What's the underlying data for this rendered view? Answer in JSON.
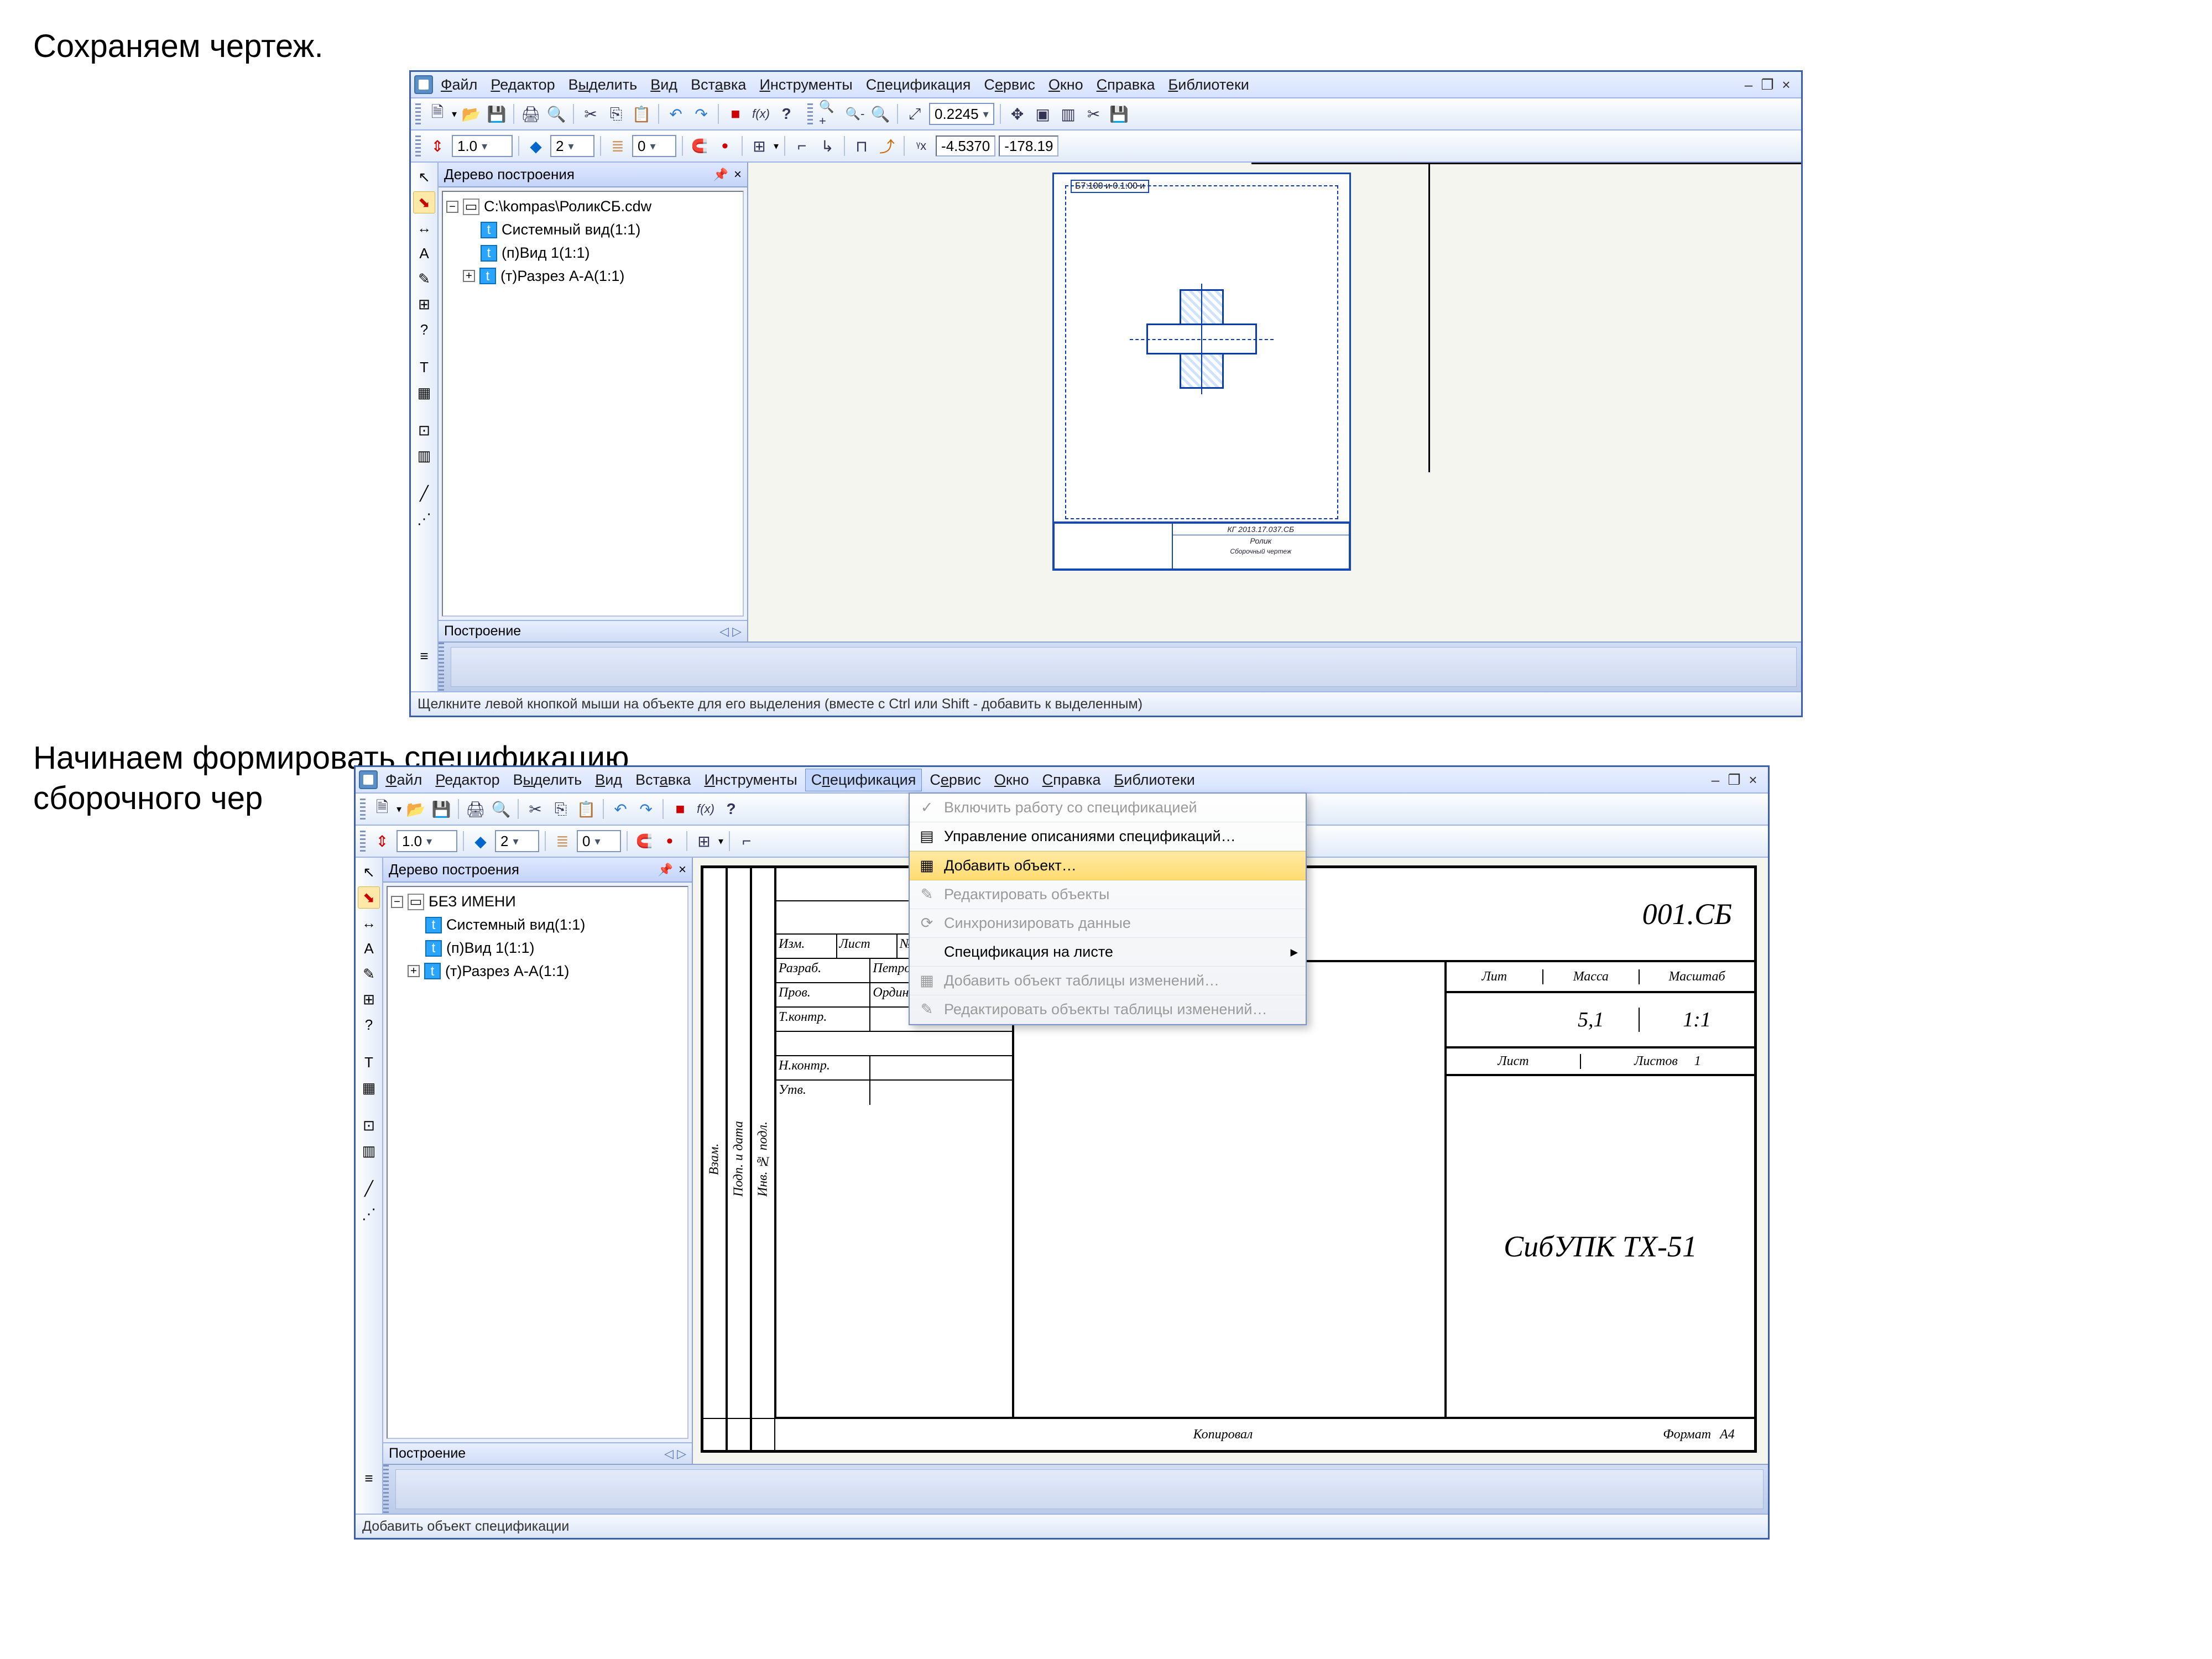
{
  "doc": {
    "text1": "Сохраняем чертеж.",
    "text2a": "Начинаем формировать спецификацию",
    "text2b": "сборочного чер"
  },
  "shot1": {
    "menubar": {
      "items": [
        "Файл",
        "Редактор",
        "Выделить",
        "Вид",
        "Вставка",
        "Инструменты",
        "Спецификация",
        "Сервис",
        "Окно",
        "Справка",
        "Библиотеки"
      ]
    },
    "toolbar2": {
      "zoom_value": "0.2245"
    },
    "toolbar3": {
      "scale": "1.0",
      "step": "2",
      "layer": "0",
      "coord_x": "-4.5370",
      "coord_y": "-178.19"
    },
    "tree": {
      "title": "Дерево построения",
      "root": "C:\\kompas\\РоликСБ.cdw",
      "items": [
        "Системный вид(1:1)",
        "(п)Вид 1(1:1)",
        "(т)Разрез А-А(1:1)"
      ]
    },
    "panel_footer": "Построение",
    "sheet_header": "Б7:100 и 0.1:00 и",
    "titleblock_code": "КГ 2013.17.037.СБ",
    "titleblock_name": "Ролик",
    "titleblock_sub": "Сборочный чертеж",
    "statusbar": "Щелкните левой кнопкой мыши на объекте для его выделения (вместе с Ctrl или Shift - добавить к выделенным)"
  },
  "shot2": {
    "menubar": {
      "items": [
        "Файл",
        "Редактор",
        "Выделить",
        "Вид",
        "Вставка",
        "Инструменты",
        "Спецификация",
        "Сервис",
        "Окно",
        "Справка",
        "Библиотеки"
      ]
    },
    "toolbar3": {
      "scale": "1.0",
      "step": "2",
      "layer": "0"
    },
    "tree": {
      "title": "Дерево построения",
      "root": "БЕЗ ИМЕНИ",
      "items": [
        "Системный вид(1:1)",
        "(п)Вид 1(1:1)",
        "(т)Разрез А-А(1:1)"
      ]
    },
    "panel_footer": "Построение",
    "dropdown": {
      "items": [
        {
          "label": "Включить работу со спецификацией",
          "disabled": true,
          "icon": "✓"
        },
        {
          "label": "Управление описаниями спецификаций…",
          "disabled": false,
          "icon": "▤"
        },
        {
          "label": "Добавить объект…",
          "disabled": false,
          "hover": true,
          "icon": "▦",
          "ul": "Д"
        },
        {
          "label": "Редактировать объекты",
          "disabled": true,
          "icon": "✎"
        },
        {
          "label": "Синхронизировать данные",
          "disabled": true,
          "icon": "⟳"
        },
        {
          "label": "Спецификация на листе",
          "disabled": false,
          "submenu": true,
          "icon": ""
        },
        {
          "label": "Добавить объект таблицы изменений…",
          "disabled": true,
          "icon": "▦"
        },
        {
          "label": "Редактировать объекты таблицы изменений…",
          "disabled": true,
          "icon": "✎"
        }
      ]
    },
    "tblock": {
      "doc_code": "001.СБ",
      "col_lit": "Лит",
      "col_mass": "Масса",
      "col_scale": "Масштаб",
      "mass": "5,1",
      "scale": "1:1",
      "sheet": "Лист",
      "sheets": "Листов",
      "sheets_n": "1",
      "org": "СибУПК ТХ-51",
      "copied": "Копировал",
      "format": "Формат",
      "format_v": "А4",
      "side_label1": "Изм.",
      "side_label2": "Лист",
      "side_label3": "№ док",
      "row_razrab": "Разраб.",
      "row_prov": "Пров.",
      "row_tkontr": "Т.контр.",
      "row_nkontr": "Н.контр.",
      "row_utv": "Утв.",
      "name_petrov": "Петров",
      "name_ordin": "Ордин.",
      "vlabel1": "Взам.",
      "vlabel2": "Инв. № подл.",
      "vlabel3": "Подп. и дата"
    },
    "statusbar": "Добавить объект спецификации"
  }
}
